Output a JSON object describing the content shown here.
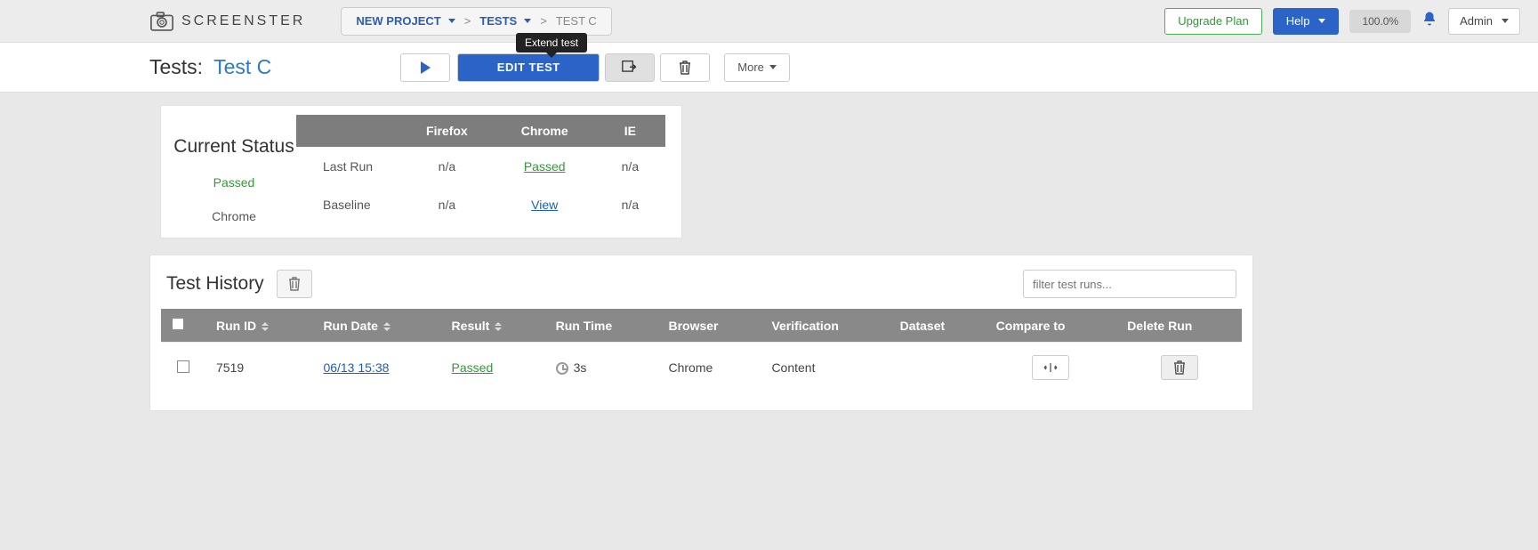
{
  "brand": "SCREENSTER",
  "breadcrumb": {
    "project": "NEW PROJECT",
    "tests": "TESTS",
    "current": "TEST C"
  },
  "header": {
    "upgrade": "Upgrade Plan",
    "help": "Help",
    "percent": "100.0%",
    "admin": "Admin"
  },
  "toolbar": {
    "prefix": "Tests: ",
    "test_name": "Test C",
    "edit": "EDIT TEST",
    "more": "More",
    "tooltip": "Extend test"
  },
  "status": {
    "title": "Current Status",
    "status_text": "Passed",
    "browser": "Chrome",
    "cols": {
      "firefox": "Firefox",
      "chrome": "Chrome",
      "ie": "IE"
    },
    "rows": {
      "last_run": {
        "label": "Last Run",
        "firefox": "n/a",
        "chrome": "Passed",
        "ie": "n/a"
      },
      "baseline": {
        "label": "Baseline",
        "firefox": "n/a",
        "chrome": "View",
        "ie": "n/a"
      }
    }
  },
  "history": {
    "title": "Test History",
    "filter_placeholder": "filter test runs...",
    "columns": {
      "run_id": "Run ID",
      "run_date": "Run Date",
      "result": "Result",
      "run_time": "Run Time",
      "browser": "Browser",
      "verification": "Verification",
      "dataset": "Dataset",
      "compare": "Compare to",
      "delete": "Delete Run"
    },
    "rows": [
      {
        "run_id": "7519",
        "run_date": "06/13 15:38",
        "result": "Passed",
        "run_time": "3s",
        "browser": "Chrome",
        "verification": "Content",
        "dataset": ""
      }
    ]
  }
}
